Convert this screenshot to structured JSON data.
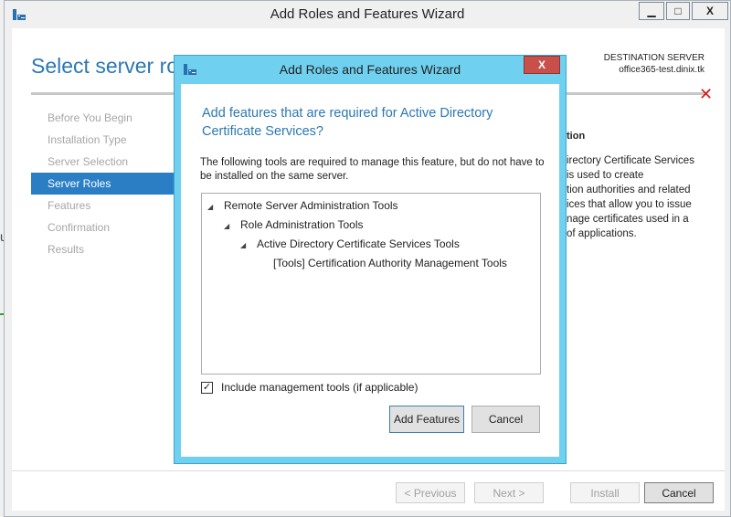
{
  "main_window": {
    "title": "Add Roles and Features Wizard",
    "controls": {
      "minimize": "▁",
      "maximize": "□",
      "close": "X"
    }
  },
  "page": {
    "heading": "Select server ro",
    "destination_label": "DESTINATION SERVER",
    "destination_server": "office365-test.dinix.tk",
    "error_icon": "✕"
  },
  "nav": {
    "items": [
      {
        "label": "Before You Begin",
        "active": false
      },
      {
        "label": "Installation Type",
        "active": false
      },
      {
        "label": "Server Selection",
        "active": false
      },
      {
        "label": "Server Roles",
        "active": true
      },
      {
        "label": "Features",
        "active": false
      },
      {
        "label": "Confirmation",
        "active": false
      },
      {
        "label": "Results",
        "active": false
      }
    ]
  },
  "description": {
    "title": "tion",
    "lines": [
      "irectory Certificate Services",
      "is used to create",
      "tion authorities and related",
      "ices that allow you to issue",
      "nage certificates used in a",
      "of applications."
    ]
  },
  "footer": {
    "previous": "< Previous",
    "next": "Next >",
    "install": "Install",
    "cancel": "Cancel"
  },
  "dialog": {
    "title": "Add Roles and Features Wizard",
    "close": "X",
    "heading": "Add features that are required for Active Directory Certificate Services?",
    "description": "The following tools are required to manage this feature, but do not have to be installed on the same server.",
    "tree": {
      "row1": "Remote Server Administration Tools",
      "row2": "Role Administration Tools",
      "row3": "Active Directory Certificate Services Tools",
      "row4": "[Tools] Certification Authority Management Tools"
    },
    "checkbox_label": "Include management tools (if applicable)",
    "checkbox_checked": true,
    "add_features": "Add Features",
    "cancel": "Cancel"
  },
  "background": {
    "partial_glyph": "u"
  },
  "colors": {
    "accent_blue": "#2b78b4",
    "nav_active": "#2c7ec4",
    "dialog_frame": "#6fd1ef",
    "error_red": "#d8171b",
    "close_red": "#c7504b"
  }
}
